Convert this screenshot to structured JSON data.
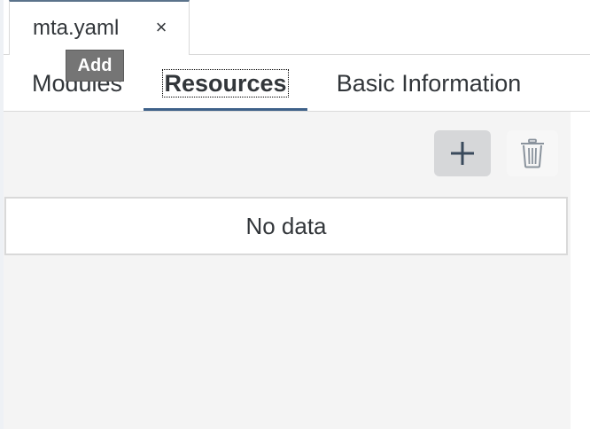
{
  "file_tab": {
    "label": "mta.yaml",
    "close_glyph": "×"
  },
  "editor_tabs": [
    {
      "label": "Modules",
      "active": false
    },
    {
      "label": "Resources",
      "active": true
    },
    {
      "label": "Basic Information",
      "active": false
    }
  ],
  "tooltip": {
    "text": "Add"
  },
  "toolbar": {
    "add_icon": "plus-icon",
    "delete_icon": "trash-icon"
  },
  "table": {
    "empty_text": "No data"
  },
  "colors": {
    "accent": "#3e6189",
    "tooltip_bg": "#757575",
    "content_bg": "#f4f4f4",
    "icon": "#3a4a5c"
  }
}
